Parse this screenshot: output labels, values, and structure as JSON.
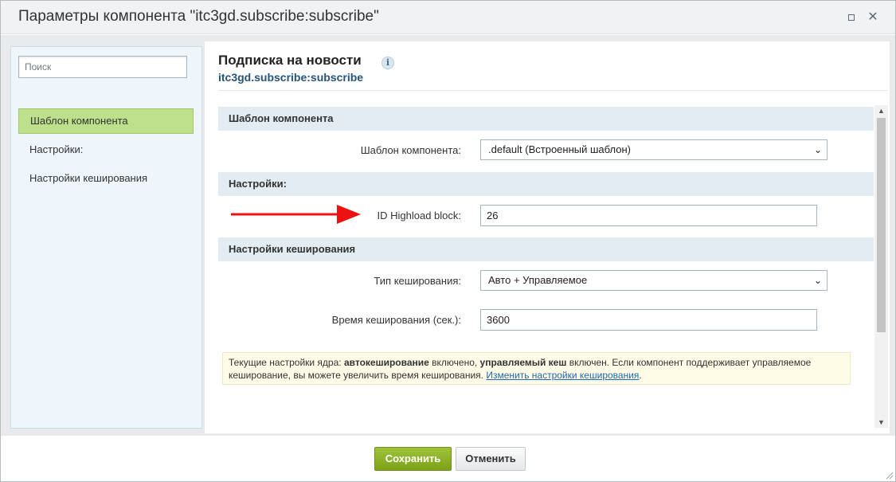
{
  "window": {
    "title": "Параметры компонента \"itc3gd.subscribe:subscribe\""
  },
  "sidebar": {
    "search_placeholder": "Поиск",
    "items": [
      {
        "label": "Шаблон компонента"
      },
      {
        "label": "Настройки:"
      },
      {
        "label": "Настройки кеширования"
      }
    ]
  },
  "main": {
    "title": "Подписка на новости",
    "info_icon": "i",
    "subtitle": "itc3gd.subscribe:subscribe",
    "sections": {
      "template": {
        "title": "Шаблон компонента",
        "field_label": "Шаблон компонента:",
        "field_value": ".default (Встроенный шаблон)"
      },
      "settings": {
        "title": "Настройки:",
        "field_label": "ID Highload block:",
        "field_value": "26"
      },
      "cache": {
        "title": "Настройки кеширования",
        "type_label": "Тип кеширования:",
        "type_value": "Авто + Управляемое",
        "time_label": "Время кеширования (сек.):",
        "time_value": "3600"
      }
    },
    "note": {
      "part1": "Текущие настройки ядра: ",
      "bold1": "автокеширование",
      "part2": " включено, ",
      "bold2": "управляемый кеш",
      "part3": " включен. Если компонент поддерживает управляемое кеширование, вы можете увеличить время кеширования. ",
      "link": "Изменить настройки кеширования",
      "part4": "."
    }
  },
  "footer": {
    "save_label": "Сохранить",
    "cancel_label": "Отменить"
  },
  "colors": {
    "accent_green": "#8db32a",
    "section_bg": "#e3ecf2",
    "annotation_arrow": "#ee1111"
  }
}
